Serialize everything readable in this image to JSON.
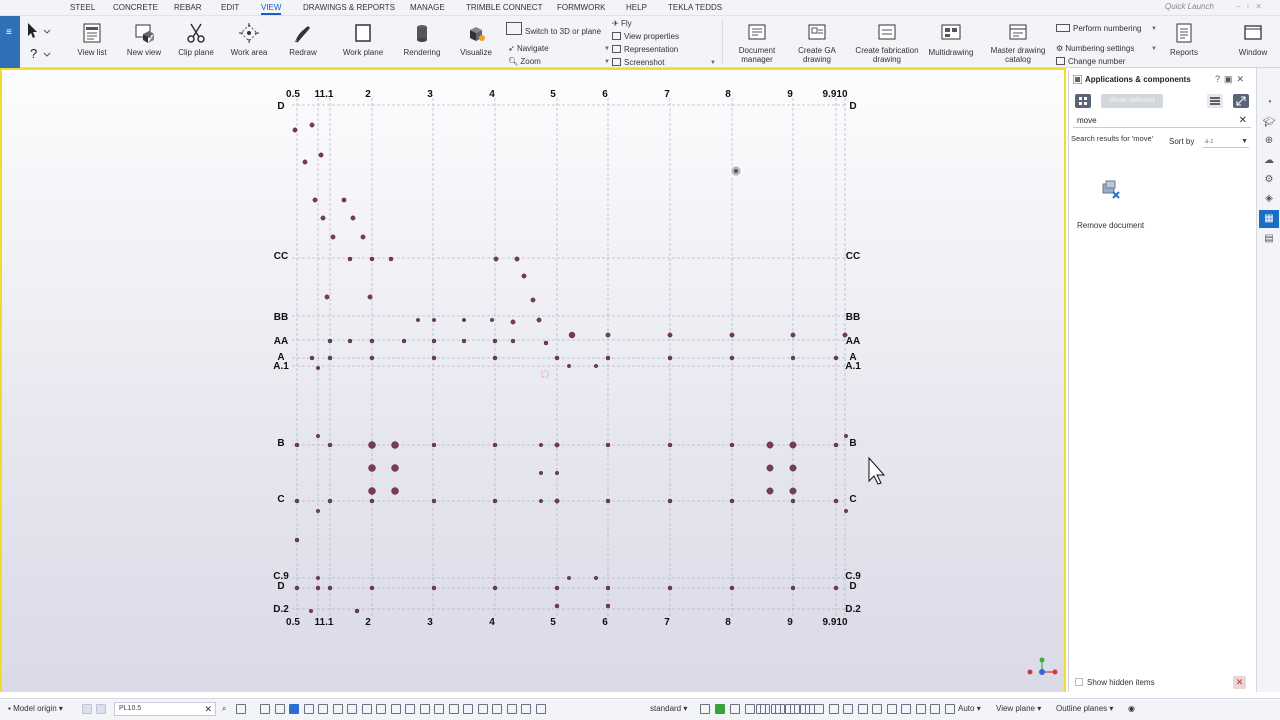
{
  "menu": {
    "tabs": [
      {
        "label": "STEEL",
        "active": false
      },
      {
        "label": "CONCRETE",
        "active": false
      },
      {
        "label": "REBAR",
        "active": false
      },
      {
        "label": "EDIT",
        "active": false
      },
      {
        "label": "VIEW",
        "active": true
      },
      {
        "label": "DRAWINGS & REPORTS",
        "active": false
      },
      {
        "label": "MANAGE",
        "active": false
      },
      {
        "label": "TRIMBLE CONNECT",
        "active": false
      },
      {
        "label": "FORMWORK",
        "active": false
      },
      {
        "label": "HELP",
        "active": false
      },
      {
        "label": "TEKLA TEDDS",
        "active": false
      }
    ],
    "quick_launch_placeholder": "Quick Launch"
  },
  "ribbon": {
    "view_list": "View list",
    "new_view": "New view",
    "clip_plane": "Clip plane",
    "work_area": "Work area",
    "redraw": "Redraw",
    "work_plane": "Work plane",
    "rendering": "Rendering",
    "visualize": "Visualize",
    "switch_3d": "Switch to 3D or plane",
    "navigate": "Navigate",
    "zoom": "Zoom",
    "fly": "Fly",
    "view_properties": "View properties",
    "representation": "Representation",
    "screenshot": "Screenshot",
    "document_manager": [
      "Document",
      "manager"
    ],
    "create_ga": [
      "Create GA",
      "drawing"
    ],
    "create_fab": [
      "Create fabrication",
      "drawing"
    ],
    "multidrawing": "Multidrawing",
    "master_catalog": [
      "Master drawing",
      "catalog"
    ],
    "perform_numbering": "Perform numbering",
    "numbering_settings": "Numbering settings",
    "change_number": "Change number",
    "reports": "Reports",
    "window": "Window"
  },
  "grid": {
    "columns_top": [
      "0.5",
      "1",
      "1.1",
      "2",
      "3",
      "4",
      "5",
      "6",
      "7",
      "8",
      "9",
      "9.1",
      "10"
    ],
    "col_header_display": [
      "0.5",
      "11.1",
      "2",
      "3",
      "4",
      "5",
      "6",
      "7",
      "8",
      "9",
      "9.910"
    ],
    "rows_left": [
      "D",
      "CC",
      "BB",
      "AA",
      "A",
      "A.1",
      "B",
      "C",
      "C.9",
      "D",
      "D.2"
    ],
    "rows_right": [
      "D",
      "CC",
      "BB",
      "AA",
      "A",
      "A.1",
      "B",
      "C",
      "C.9",
      "D",
      "D.2"
    ]
  },
  "panel": {
    "title": "Applications & components",
    "show_selected": "Show selected",
    "search_value": "move",
    "search_results": "Search results for 'move'",
    "sort_label": "Sort by",
    "sort_value": "a-z",
    "result_item": "Remove document",
    "show_hidden": "Show hidden items"
  },
  "status": {
    "model_origin": "Model origin",
    "command_value": "PL10.5",
    "standard": "standard",
    "auto": "Auto",
    "view_plane": "View plane",
    "outline_planes": "Outline planes"
  },
  "colors": {
    "accent": "#1a5cc8",
    "highlight_border": "#f2dc2a",
    "point_fill": "#7a3a5c",
    "grid_line": "#b9b9c8"
  }
}
